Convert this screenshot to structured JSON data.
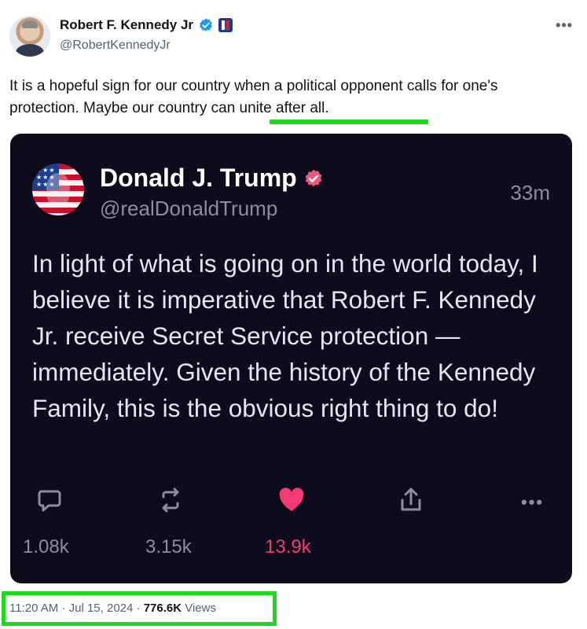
{
  "author": {
    "display_name": "Robert F. Kennedy Jr",
    "handle": "@RobertKennedyJr",
    "verified_icon": "verified-badge-icon",
    "affiliation_icon": "flag-badge-icon"
  },
  "menu_icon": "more-options-icon",
  "tweet": {
    "text": "It is a hopeful sign for our country when a political opponent calls for one's protection. Maybe our country can unite after all."
  },
  "embedded_post": {
    "display_name": "Donald J. Trump",
    "handle": "@realDonaldTrump",
    "time_ago": "33m",
    "body": "In light of what is going on in the world today, I believe it is imperative that Robert F. Kennedy Jr. receive Secret Service protection — immediately. Given the history of the Kennedy Family, this is the obvious right thing to do!",
    "actions": {
      "reply_count": "1.08k",
      "retruth_count": "3.15k",
      "like_count": "13.9k",
      "more_label": "•••"
    }
  },
  "meta": {
    "time": "11:20 AM",
    "sep1": "·",
    "date": "Jul 15, 2024",
    "sep2": "·",
    "views_count": "776.6K",
    "views_label": "Views"
  },
  "colors": {
    "highlight": "#1ed91e",
    "verified_blue": "#1d9bf0",
    "embed_bg": "#0e0c1c",
    "like_pink": "#f43a74"
  }
}
